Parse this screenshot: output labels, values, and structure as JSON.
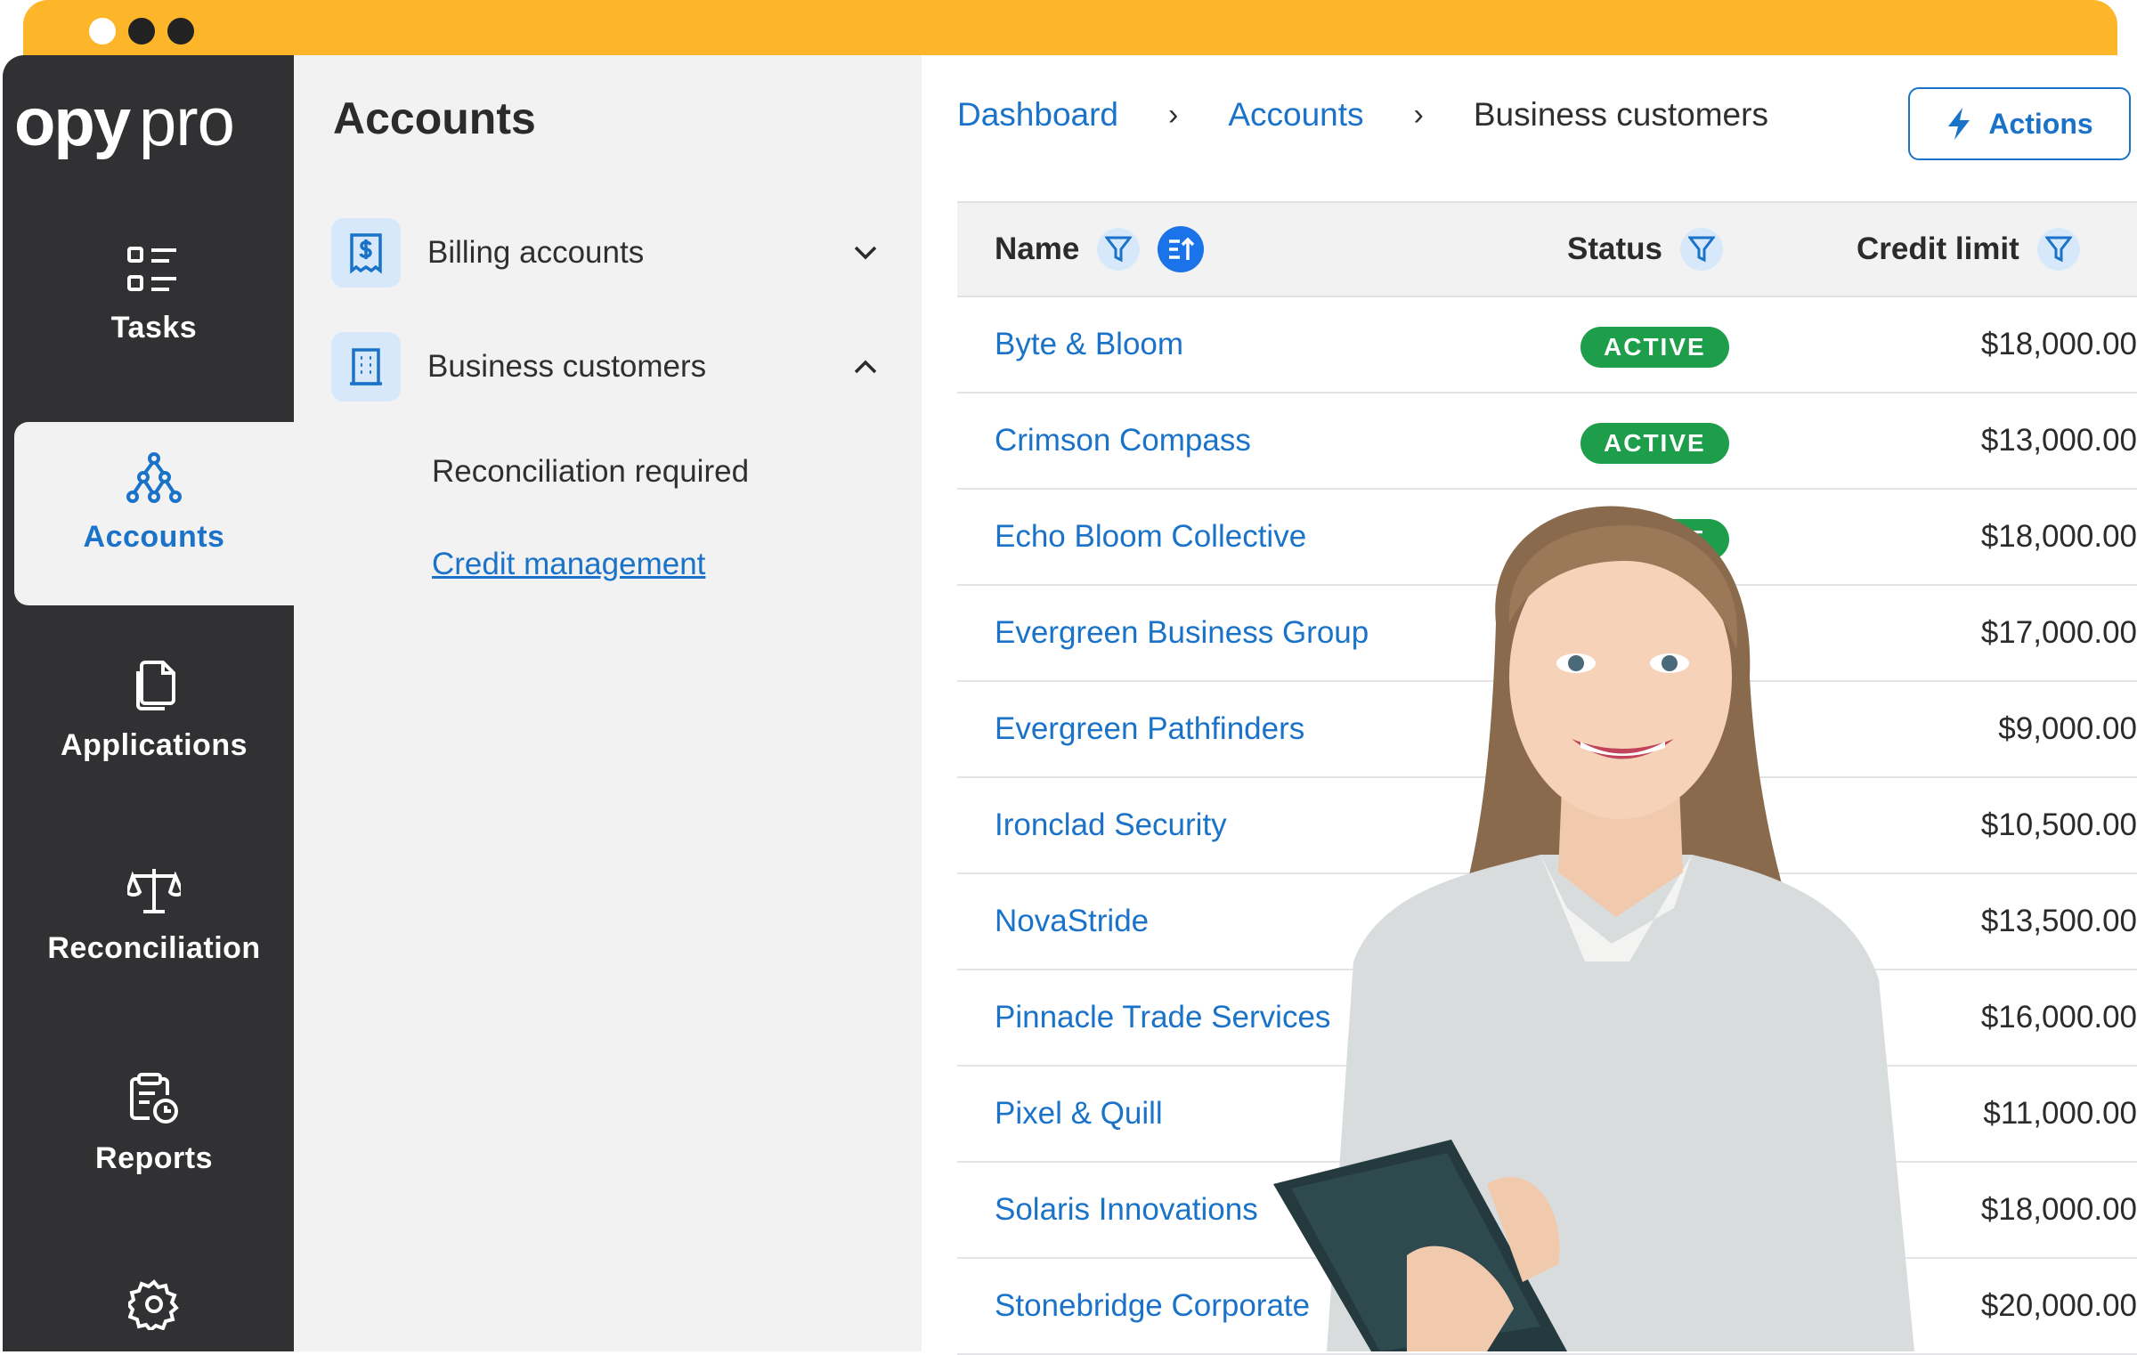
{
  "colors": {
    "window_bar": "#fdb52a",
    "sidebar_bg": "#313133",
    "panel_bg": "#f2f2f3",
    "accent": "#1a73c8",
    "badge_active": "#1e9e4a"
  },
  "window": {
    "dots": [
      "#ffffff",
      "#222222",
      "#222222"
    ]
  },
  "brand": {
    "logo_text": "opypro"
  },
  "sidebar": {
    "items": [
      {
        "label": "Tasks",
        "icon": "tasks-icon"
      },
      {
        "label": "Accounts",
        "icon": "accounts-icon",
        "active": true
      },
      {
        "label": "Applications",
        "icon": "applications-icon"
      },
      {
        "label": "Reconciliation",
        "icon": "scale-icon"
      },
      {
        "label": "Reports",
        "icon": "reports-icon"
      },
      {
        "label": "",
        "icon": "gear-icon"
      }
    ]
  },
  "subpanel": {
    "title": "Accounts",
    "groups": [
      {
        "label": "Billing accounts",
        "icon": "receipt-dollar-icon",
        "expanded": false
      },
      {
        "label": "Business customers",
        "icon": "building-icon",
        "expanded": true
      }
    ],
    "children": [
      {
        "label": "Reconciliation required"
      },
      {
        "label": "Credit management",
        "link": true
      }
    ]
  },
  "breadcrumb": {
    "items": [
      "Dashboard",
      "Accounts"
    ],
    "separator": "›",
    "current": "Business customers"
  },
  "actions_button": {
    "label": "Actions",
    "icon": "lightning-icon"
  },
  "table": {
    "columns": [
      "Name",
      "Status",
      "Credit limit"
    ],
    "rows": [
      {
        "name": "Byte & Bloom",
        "status": "ACTIVE",
        "credit": "$18,000.00"
      },
      {
        "name": "Crimson Compass",
        "status": "ACTIVE",
        "credit": "$13,000.00"
      },
      {
        "name": "Echo Bloom Collective",
        "status": "ACTIVE",
        "credit": "$18,000.00"
      },
      {
        "name": "Evergreen Business Group",
        "status": "",
        "credit": "$17,000.00"
      },
      {
        "name": "Evergreen Pathfinders",
        "status": "",
        "credit": "$9,000.00"
      },
      {
        "name": "Ironclad Security",
        "status": "",
        "credit": "$10,500.00"
      },
      {
        "name": "NovaStride",
        "status": "",
        "credit": "$13,500.00"
      },
      {
        "name": "Pinnacle Trade Services",
        "status": "",
        "credit": "$16,000.00"
      },
      {
        "name": "Pixel & Quill",
        "status": "",
        "credit": "$11,000.00"
      },
      {
        "name": "Solaris Innovations",
        "status": "",
        "credit": "$18,000.00"
      },
      {
        "name": "Stonebridge Corporate",
        "status": "",
        "credit": "$20,000.00"
      }
    ]
  }
}
